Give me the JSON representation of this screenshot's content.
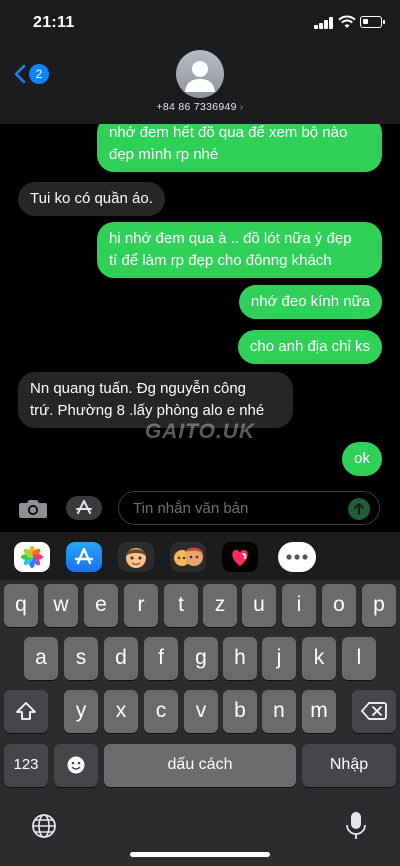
{
  "status_bar": {
    "time": "21:11",
    "battery_level_percent": 30
  },
  "header": {
    "unread_count": "2",
    "contact_phone": "+84 86 7336949"
  },
  "messages": [
    {
      "direction": "outgoing",
      "text": "nhớ đem hết đồ qua để xem bộ nào\nđẹp mình rp nhé"
    },
    {
      "direction": "incoming",
      "text": "Tui ko có quần áo."
    },
    {
      "direction": "outgoing",
      "text": "hi nhớ đem qua à .. đồ lót nữa ý đẹp\ntí để làm rp đẹp cho đônng khách"
    },
    {
      "direction": "outgoing",
      "text": "nhớ đeo kính nữa"
    },
    {
      "direction": "outgoing",
      "text": "cho anh địa chỉ ks"
    },
    {
      "direction": "incoming",
      "text": "Nn quang tuấn. Đg nguyễn công\ntrứ. Phường 8 .lấy phòng alo e nhé"
    },
    {
      "direction": "outgoing",
      "text": "ok"
    }
  ],
  "watermark": "GAITO.UK",
  "composer": {
    "placeholder": "Tin nhắn văn bản"
  },
  "app_drawer": [
    {
      "name": "photos-app-icon"
    },
    {
      "name": "appstore-app-icon"
    },
    {
      "name": "memoji-app-icon"
    },
    {
      "name": "memoji-stickers-app-icon"
    },
    {
      "name": "digital-touch-app-icon"
    },
    {
      "name": "more-apps-icon"
    }
  ],
  "keyboard": {
    "row1": [
      "q",
      "w",
      "e",
      "r",
      "t",
      "z",
      "u",
      "i",
      "o",
      "p"
    ],
    "row2": [
      "a",
      "s",
      "d",
      "f",
      "g",
      "h",
      "j",
      "k",
      "l"
    ],
    "row3": [
      "y",
      "x",
      "c",
      "v",
      "b",
      "n",
      "m"
    ],
    "numbers_label": "123",
    "space_label": "dấu cách",
    "return_label": "Nhập"
  },
  "colors": {
    "outgoing_bubble": "#30d158",
    "incoming_bubble": "#262628",
    "accent": "#0a84ff"
  }
}
